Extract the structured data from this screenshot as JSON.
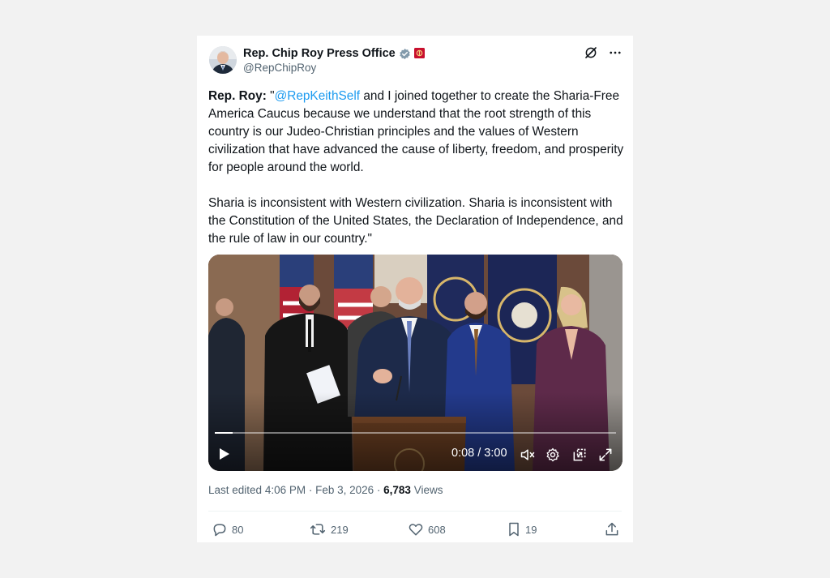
{
  "author": {
    "display_name": "Rep. Chip Roy Press Office",
    "handle": "@RepChipRoy",
    "verified_badge_icon": "gray-verified-check-icon",
    "affiliate_badge_icon": "house-seal-badge-icon",
    "avatar_icon": "profile-photo"
  },
  "top_icons": [
    "grok-slash-icon",
    "more-dots-icon"
  ],
  "tweet": {
    "p1_bold": "Rep. Roy:",
    "p1_open_quote": " \"",
    "p1_mention": "@RepKeithSelf",
    "p1_rest": " and I joined together to create the Sharia-Free America Caucus because we understand that the root strength of this country is our Judeo-Christian principles and the values of Western civilization that have advanced the cause of liberty, freedom, and prosperity for people around the world.",
    "p2": "Sharia is inconsistent with Western civilization. Sharia is inconsistent with the Constitution of the United States, the Declaration of Independence, and the rule of law in our country.\""
  },
  "video": {
    "time_display": "0:08 / 3:00",
    "progress": 0.044,
    "controls": [
      "play-icon",
      "muted-speaker-icon",
      "settings-gear-icon",
      "pop-out-icon",
      "fullscreen-expand-icon"
    ]
  },
  "meta": {
    "edited_prefix": "Last edited ",
    "time": "4:06 PM",
    "separator": " · ",
    "date": "Feb 3, 2026",
    "separator2": " · ",
    "views_count": "6,783",
    "views_label": " Views"
  },
  "actions": {
    "replies": "80",
    "reposts": "219",
    "likes": "608",
    "bookmarks": "19"
  },
  "colors": {
    "link": "#1d9bf0",
    "secondary_text": "#536471",
    "primary_text": "#0f1419"
  }
}
